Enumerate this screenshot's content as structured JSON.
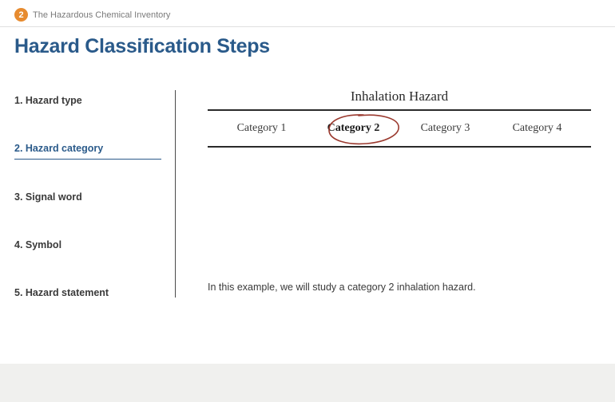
{
  "header": {
    "badge": "2",
    "breadcrumb": "The Hazardous Chemical Inventory"
  },
  "title": "Hazard Classification Steps",
  "steps": [
    {
      "label": "1. Hazard type",
      "active": false
    },
    {
      "label": "2. Hazard category",
      "active": true
    },
    {
      "label": "3. Signal word",
      "active": false
    },
    {
      "label": "4. Symbol",
      "active": false
    },
    {
      "label": "5. Hazard statement",
      "active": false
    }
  ],
  "hazard": {
    "title": "Inhalation Hazard",
    "categories": [
      "Category 1",
      "Category 2",
      "Category 3",
      "Category 4"
    ],
    "highlighted_index": 1
  },
  "caption": "In this example, we will study a category 2 inhalation hazard."
}
